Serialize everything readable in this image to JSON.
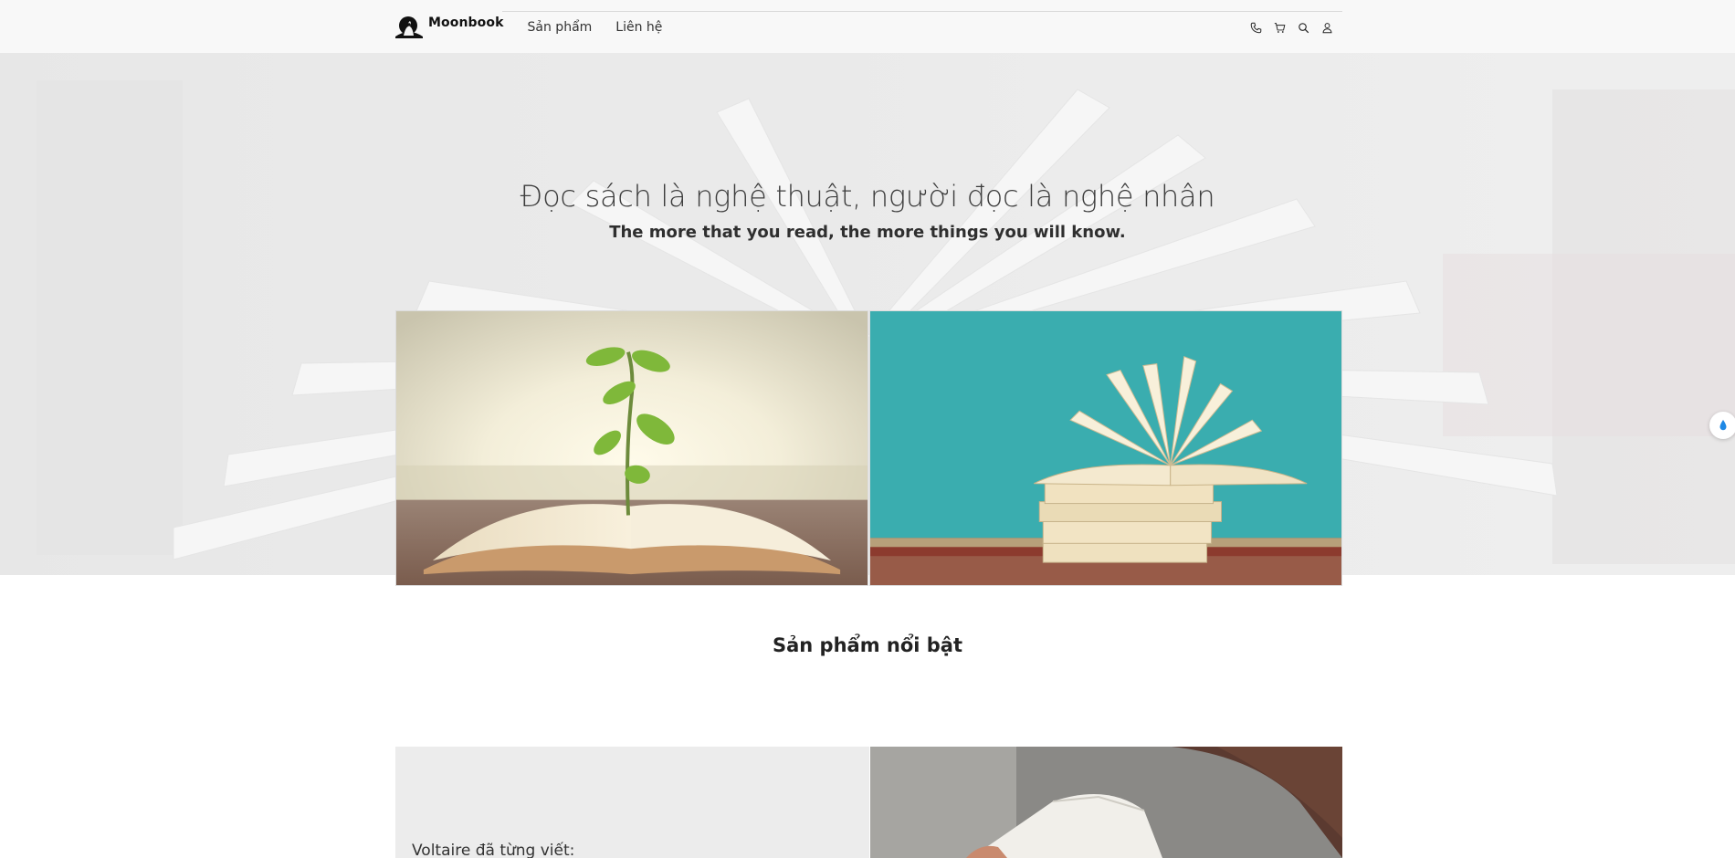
{
  "header": {
    "brand": "Moonbook",
    "nav": [
      {
        "label": "Sản phẩm"
      },
      {
        "label": "Liên hệ"
      }
    ],
    "icons": [
      "phone-icon",
      "cart-icon",
      "search-icon",
      "user-icon"
    ]
  },
  "hero": {
    "title": "Đọc sách là nghệ thuật, người đọc là nghệ nhân",
    "subtitle": "The more that you read, the more things you will know."
  },
  "featured": {
    "title": "Sản phẩm nổi bật"
  },
  "quote": {
    "text": "Voltaire đã từng viết:"
  },
  "colors": {
    "background": "#ffffff",
    "header_bg": "#f8f8f8",
    "hero_bg": "#ececec",
    "quote_bg": "#ececec",
    "teal_wall": "#3fb2b4",
    "text_dark": "#222222"
  }
}
